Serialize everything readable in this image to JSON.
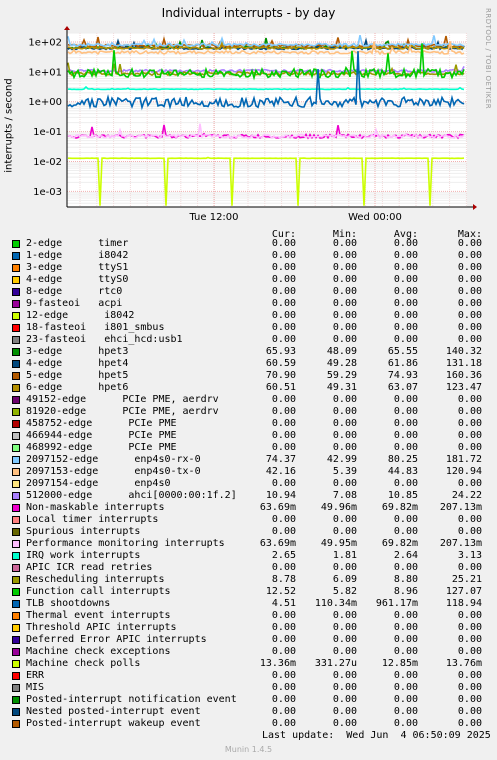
{
  "chart_data": {
    "type": "line",
    "title": "Individual interrupts - by day",
    "ylabel": "interrupts / second",
    "yscale": "log",
    "ylim": [
      0.0003,
      200
    ],
    "yticks": [
      "1e+02",
      "1e+01",
      "1e+00",
      "1e-01",
      "1e-02",
      "1e-03"
    ],
    "xticks": [
      "Tue 12:00",
      "Wed 00:00"
    ],
    "grid": true,
    "credit": "RRDTOOL / TOBI OETIKER",
    "columns": [
      "Cur:",
      "Min:",
      "Avg:",
      "Max:"
    ],
    "series": [
      {
        "name": "2-edge      timer",
        "color": "#00cc00",
        "cur": "0.00",
        "min": "0.00",
        "avg": "0.00",
        "max": "0.00"
      },
      {
        "name": "1-edge      i8042",
        "color": "#0066b3",
        "cur": "0.00",
        "min": "0.00",
        "avg": "0.00",
        "max": "0.00"
      },
      {
        "name": "3-edge      ttyS1",
        "color": "#ff8000",
        "cur": "0.00",
        "min": "0.00",
        "avg": "0.00",
        "max": "0.00"
      },
      {
        "name": "4-edge      ttyS0",
        "color": "#ffcc00",
        "cur": "0.00",
        "min": "0.00",
        "avg": "0.00",
        "max": "0.00"
      },
      {
        "name": "8-edge      rtc0",
        "color": "#330099",
        "cur": "0.00",
        "min": "0.00",
        "avg": "0.00",
        "max": "0.00"
      },
      {
        "name": "9-fasteoi   acpi",
        "color": "#990099",
        "cur": "0.00",
        "min": "0.00",
        "avg": "0.00",
        "max": "0.00"
      },
      {
        "name": "12-edge      i8042",
        "color": "#ccff00",
        "cur": "0.00",
        "min": "0.00",
        "avg": "0.00",
        "max": "0.00"
      },
      {
        "name": "18-fasteoi   i801_smbus",
        "color": "#ff0000",
        "cur": "0.00",
        "min": "0.00",
        "avg": "0.00",
        "max": "0.00"
      },
      {
        "name": "23-fasteoi   ehci_hcd:usb1",
        "color": "#808080",
        "cur": "0.00",
        "min": "0.00",
        "avg": "0.00",
        "max": "0.00"
      },
      {
        "name": "3-edge      hpet3",
        "color": "#008f00",
        "cur": "65.93",
        "min": "48.09",
        "avg": "65.55",
        "max": "140.32"
      },
      {
        "name": "4-edge      hpet4",
        "color": "#00487d",
        "cur": "60.59",
        "min": "49.28",
        "avg": "61.86",
        "max": "131.18"
      },
      {
        "name": "5-edge      hpet5",
        "color": "#b35a00",
        "cur": "70.90",
        "min": "59.29",
        "avg": "74.93",
        "max": "160.36"
      },
      {
        "name": "6-edge      hpet6",
        "color": "#b38f00",
        "cur": "60.51",
        "min": "49.31",
        "avg": "63.07",
        "max": "123.47"
      },
      {
        "name": "49152-edge      PCIe PME, aerdrv",
        "color": "#6b006b",
        "cur": "0.00",
        "min": "0.00",
        "avg": "0.00",
        "max": "0.00"
      },
      {
        "name": "81920-edge      PCIe PME, aerdrv",
        "color": "#8fb300",
        "cur": "0.00",
        "min": "0.00",
        "avg": "0.00",
        "max": "0.00"
      },
      {
        "name": "458752-edge      PCIe PME",
        "color": "#b30000",
        "cur": "0.00",
        "min": "0.00",
        "avg": "0.00",
        "max": "0.00"
      },
      {
        "name": "466944-edge      PCIe PME",
        "color": "#bebebe",
        "cur": "0.00",
        "min": "0.00",
        "avg": "0.00",
        "max": "0.00"
      },
      {
        "name": "468992-edge      PCIe PME",
        "color": "#80ff80",
        "cur": "0.00",
        "min": "0.00",
        "avg": "0.00",
        "max": "0.00"
      },
      {
        "name": "2097152-edge      enp4s0-rx-0",
        "color": "#80c9ff",
        "cur": "74.37",
        "min": "42.99",
        "avg": "80.25",
        "max": "181.72"
      },
      {
        "name": "2097153-edge      enp4s0-tx-0",
        "color": "#ffc080",
        "cur": "42.16",
        "min": "5.39",
        "avg": "44.83",
        "max": "120.94"
      },
      {
        "name": "2097154-edge      enp4s0",
        "color": "#ffe680",
        "cur": "0.00",
        "min": "0.00",
        "avg": "0.00",
        "max": "0.00"
      },
      {
        "name": "512000-edge      ahci[0000:00:1f.2]",
        "color": "#aa80ff",
        "cur": "10.94",
        "min": "7.08",
        "avg": "10.85",
        "max": "24.22"
      },
      {
        "name": "Non-maskable interrupts",
        "color": "#ee00cc",
        "cur": "63.69m",
        "min": "49.96m",
        "avg": "69.82m",
        "max": "207.13m"
      },
      {
        "name": "Local timer interrupts",
        "color": "#ff8080",
        "cur": "0.00",
        "min": "0.00",
        "avg": "0.00",
        "max": "0.00"
      },
      {
        "name": "Spurious interrupts",
        "color": "#666600",
        "cur": "0.00",
        "min": "0.00",
        "avg": "0.00",
        "max": "0.00"
      },
      {
        "name": "Performance monitoring interrupts",
        "color": "#ffbfff",
        "cur": "63.69m",
        "min": "49.95m",
        "avg": "69.82m",
        "max": "207.13m"
      },
      {
        "name": "IRQ work interrupts",
        "color": "#00ffcc",
        "cur": "2.65",
        "min": "1.81",
        "avg": "2.64",
        "max": "3.13"
      },
      {
        "name": "APIC ICR read retries",
        "color": "#cc6699",
        "cur": "0.00",
        "min": "0.00",
        "avg": "0.00",
        "max": "0.00"
      },
      {
        "name": "Rescheduling interrupts",
        "color": "#999900",
        "cur": "8.78",
        "min": "6.09",
        "avg": "8.80",
        "max": "25.21"
      },
      {
        "name": "Function call interrupts",
        "color": "#00cc00",
        "cur": "12.52",
        "min": "5.82",
        "avg": "8.96",
        "max": "127.07"
      },
      {
        "name": "TLB shootdowns",
        "color": "#0066b3",
        "cur": "4.51",
        "min": "110.34m",
        "avg": "961.17m",
        "max": "118.94"
      },
      {
        "name": "Thermal event interrupts",
        "color": "#ff8000",
        "cur": "0.00",
        "min": "0.00",
        "avg": "0.00",
        "max": "0.00"
      },
      {
        "name": "Threshold APIC interrupts",
        "color": "#ffcc00",
        "cur": "0.00",
        "min": "0.00",
        "avg": "0.00",
        "max": "0.00"
      },
      {
        "name": "Deferred Error APIC interrupts",
        "color": "#330099",
        "cur": "0.00",
        "min": "0.00",
        "avg": "0.00",
        "max": "0.00"
      },
      {
        "name": "Machine check exceptions",
        "color": "#990099",
        "cur": "0.00",
        "min": "0.00",
        "avg": "0.00",
        "max": "0.00"
      },
      {
        "name": "Machine check polls",
        "color": "#ccff00",
        "cur": "13.36m",
        "min": "331.27u",
        "avg": "12.85m",
        "max": "13.76m"
      },
      {
        "name": "ERR",
        "color": "#ff0000",
        "cur": "0.00",
        "min": "0.00",
        "avg": "0.00",
        "max": "0.00"
      },
      {
        "name": "MIS",
        "color": "#808080",
        "cur": "0.00",
        "min": "0.00",
        "avg": "0.00",
        "max": "0.00"
      },
      {
        "name": "Posted-interrupt notification event",
        "color": "#008f00",
        "cur": "0.00",
        "min": "0.00",
        "avg": "0.00",
        "max": "0.00"
      },
      {
        "name": "Nested posted-interrupt event",
        "color": "#00487d",
        "cur": "0.00",
        "min": "0.00",
        "avg": "0.00",
        "max": "0.00"
      },
      {
        "name": "Posted-interrupt wakeup event",
        "color": "#b35a00",
        "cur": "0.00",
        "min": "0.00",
        "avg": "0.00",
        "max": "0.00"
      }
    ]
  },
  "footer": {
    "last_update": "Last update:  Wed Jun  4 06:50:09 2025",
    "munin": "Munin 1.4.5"
  }
}
